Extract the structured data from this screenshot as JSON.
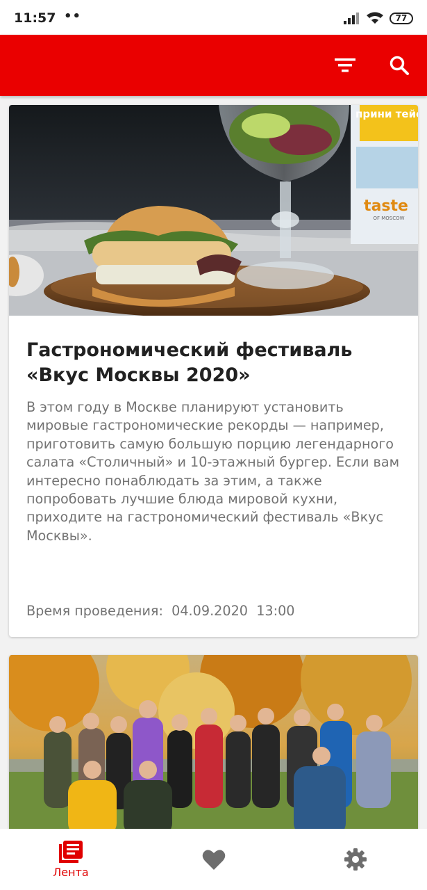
{
  "status_bar": {
    "time": "11:57",
    "dots": "••",
    "battery": "77"
  },
  "toolbar": {
    "filter_icon": "filter-icon",
    "search_icon": "search-icon",
    "color": "#ea0000"
  },
  "feed": [
    {
      "image": "food-festival-photo",
      "image_text": {
        "sign_top": "прини тейс",
        "sign_brand": "taste",
        "sign_sub": "OF MOSCOW"
      },
      "title": "Гастрономический фестиваль «Вкус Москвы 2020»",
      "description": "В этом году в Москве планируют установить мировые гастрономические рекорды — например, приготовить самую большую порцию легендарного салата «Столичный» и 10-этажный бургер. Если вам интересно понаблюдать за этим, а также попробовать лучшие блюда мировой кухни, приходите на гастрономический фестиваль «Вкус Москвы».",
      "time_label": "Время проведения:",
      "date": "04.09.2020",
      "time": "13:00"
    },
    {
      "image": "group-photo-autumn-park"
    }
  ],
  "bottom_nav": {
    "items": [
      {
        "label": "Лента",
        "icon": "feed-icon",
        "active": true
      },
      {
        "label": "",
        "icon": "heart-icon",
        "active": false
      },
      {
        "label": "",
        "icon": "gear-icon",
        "active": false
      }
    ],
    "active_color": "#e00000",
    "inactive_color": "#6d6d6d"
  }
}
